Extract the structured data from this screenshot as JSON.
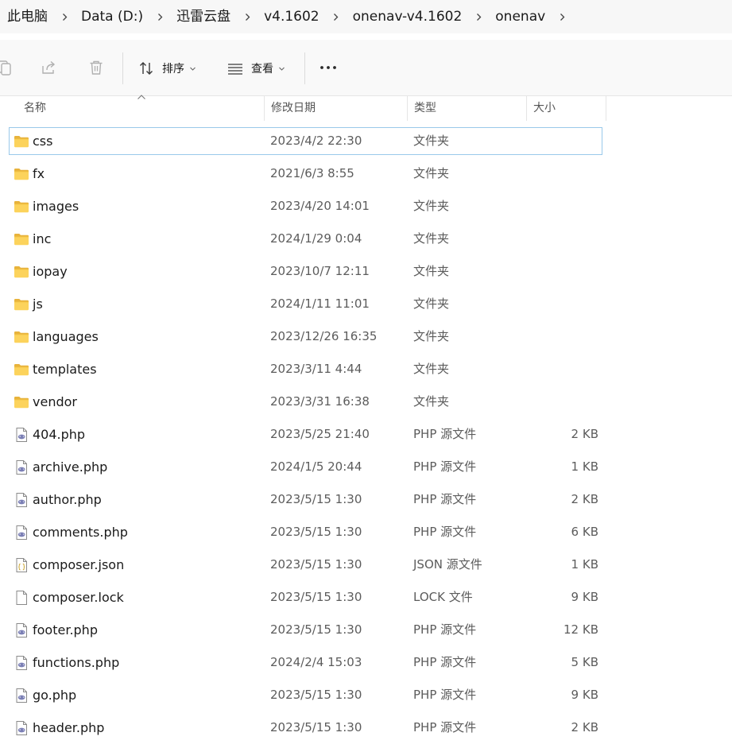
{
  "breadcrumb": {
    "items": [
      {
        "label": "此电脑"
      },
      {
        "label": "Data (D:)"
      },
      {
        "label": "迅雷云盘"
      },
      {
        "label": "v4.1602"
      },
      {
        "label": "onenav-v4.1602"
      },
      {
        "label": "onenav"
      }
    ]
  },
  "toolbar": {
    "sort_label": "排序",
    "view_label": "查看",
    "more_label": "•••"
  },
  "columns": {
    "name": "名称",
    "date": "修改日期",
    "type": "类型",
    "size": "大小"
  },
  "files": [
    {
      "name": "css",
      "date": "2023/4/2 22:30",
      "type": "文件夹",
      "size": "",
      "icon": "folder-icon",
      "selected": true
    },
    {
      "name": "fx",
      "date": "2021/6/3 8:55",
      "type": "文件夹",
      "size": "",
      "icon": "folder-icon"
    },
    {
      "name": "images",
      "date": "2023/4/20 14:01",
      "type": "文件夹",
      "size": "",
      "icon": "folder-icon"
    },
    {
      "name": "inc",
      "date": "2024/1/29 0:04",
      "type": "文件夹",
      "size": "",
      "icon": "folder-icon"
    },
    {
      "name": "iopay",
      "date": "2023/10/7 12:11",
      "type": "文件夹",
      "size": "",
      "icon": "folder-icon"
    },
    {
      "name": "js",
      "date": "2024/1/11 11:01",
      "type": "文件夹",
      "size": "",
      "icon": "folder-icon"
    },
    {
      "name": "languages",
      "date": "2023/12/26 16:35",
      "type": "文件夹",
      "size": "",
      "icon": "folder-icon"
    },
    {
      "name": "templates",
      "date": "2023/3/11 4:44",
      "type": "文件夹",
      "size": "",
      "icon": "folder-icon"
    },
    {
      "name": "vendor",
      "date": "2023/3/31 16:38",
      "type": "文件夹",
      "size": "",
      "icon": "folder-icon"
    },
    {
      "name": "404.php",
      "date": "2023/5/25 21:40",
      "type": "PHP 源文件",
      "size": "2 KB",
      "icon": "php-file-icon"
    },
    {
      "name": "archive.php",
      "date": "2024/1/5 20:44",
      "type": "PHP 源文件",
      "size": "1 KB",
      "icon": "php-file-icon"
    },
    {
      "name": "author.php",
      "date": "2023/5/15 1:30",
      "type": "PHP 源文件",
      "size": "2 KB",
      "icon": "php-file-icon"
    },
    {
      "name": "comments.php",
      "date": "2023/5/15 1:30",
      "type": "PHP 源文件",
      "size": "6 KB",
      "icon": "php-file-icon"
    },
    {
      "name": "composer.json",
      "date": "2023/5/15 1:30",
      "type": "JSON 源文件",
      "size": "1 KB",
      "icon": "json-file-icon"
    },
    {
      "name": "composer.lock",
      "date": "2023/5/15 1:30",
      "type": "LOCK 文件",
      "size": "9 KB",
      "icon": "blank-file-icon"
    },
    {
      "name": "footer.php",
      "date": "2023/5/15 1:30",
      "type": "PHP 源文件",
      "size": "12 KB",
      "icon": "php-file-icon"
    },
    {
      "name": "functions.php",
      "date": "2024/2/4 15:03",
      "type": "PHP 源文件",
      "size": "5 KB",
      "icon": "php-file-icon"
    },
    {
      "name": "go.php",
      "date": "2023/5/15 1:30",
      "type": "PHP 源文件",
      "size": "9 KB",
      "icon": "php-file-icon"
    },
    {
      "name": "header.php",
      "date": "2023/5/15 1:30",
      "type": "PHP 源文件",
      "size": "2 KB",
      "icon": "php-file-icon"
    }
  ]
}
